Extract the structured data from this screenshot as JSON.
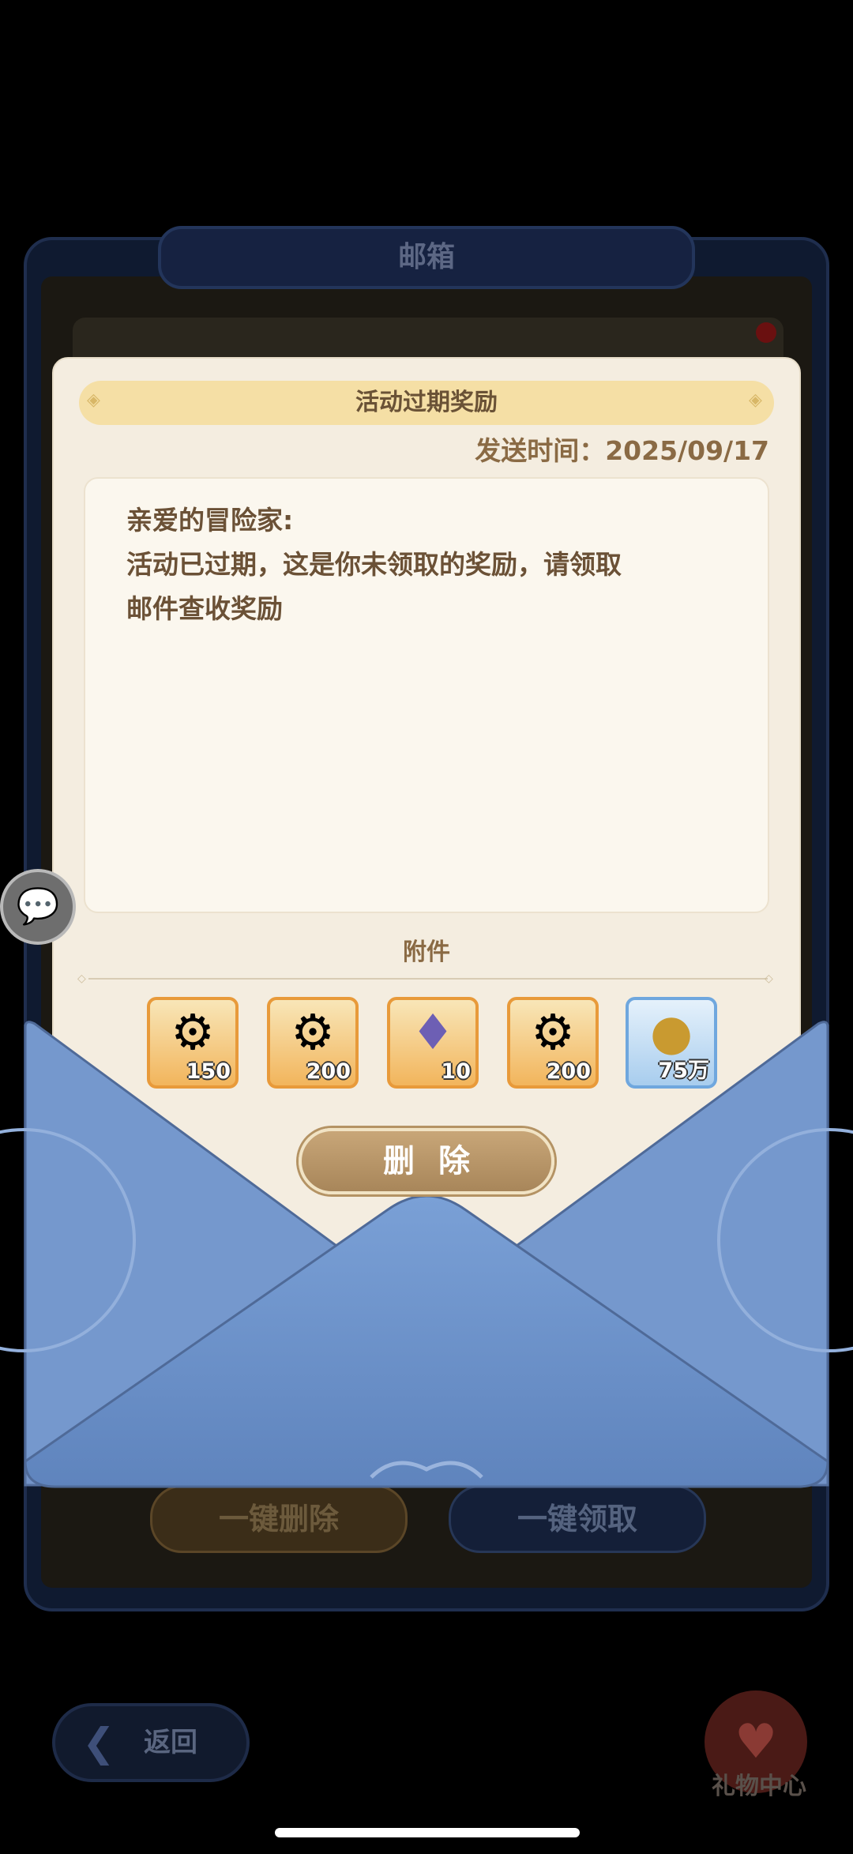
{
  "mailbox": {
    "title": "邮箱",
    "delete_all_label": "一键删除",
    "claim_all_label": "一键领取",
    "back_label": "返回",
    "gift_center_label": "礼物中心"
  },
  "mail": {
    "title": "活动过期奖励",
    "send_time_label": "发送时间：",
    "send_time_value": "2025/09/17",
    "greeting": "亲爱的冒险家:",
    "body_line1": "活动已过期，这是你未领取的奖励，请领取",
    "body_line2": "邮件查收奖励",
    "attachments_title": "附件",
    "attachments": [
      {
        "icon": "gear-canister-icon",
        "count": "150",
        "frame": "orange"
      },
      {
        "icon": "gear-canister-icon",
        "count": "200",
        "frame": "orange"
      },
      {
        "icon": "purple-crystal-icon",
        "count": "10",
        "frame": "orange"
      },
      {
        "icon": "gear-canister-icon",
        "count": "200",
        "frame": "orange"
      },
      {
        "icon": "gold-coin-icon",
        "count": "75万",
        "frame": "blue"
      }
    ],
    "delete_label": "删除"
  },
  "colors": {
    "card": "#f4ede0",
    "title_bar": "#f5dfa5",
    "text_brown": "#6b5136",
    "envelope_blue": "#7193c7",
    "button_tan": "#b8966a"
  }
}
